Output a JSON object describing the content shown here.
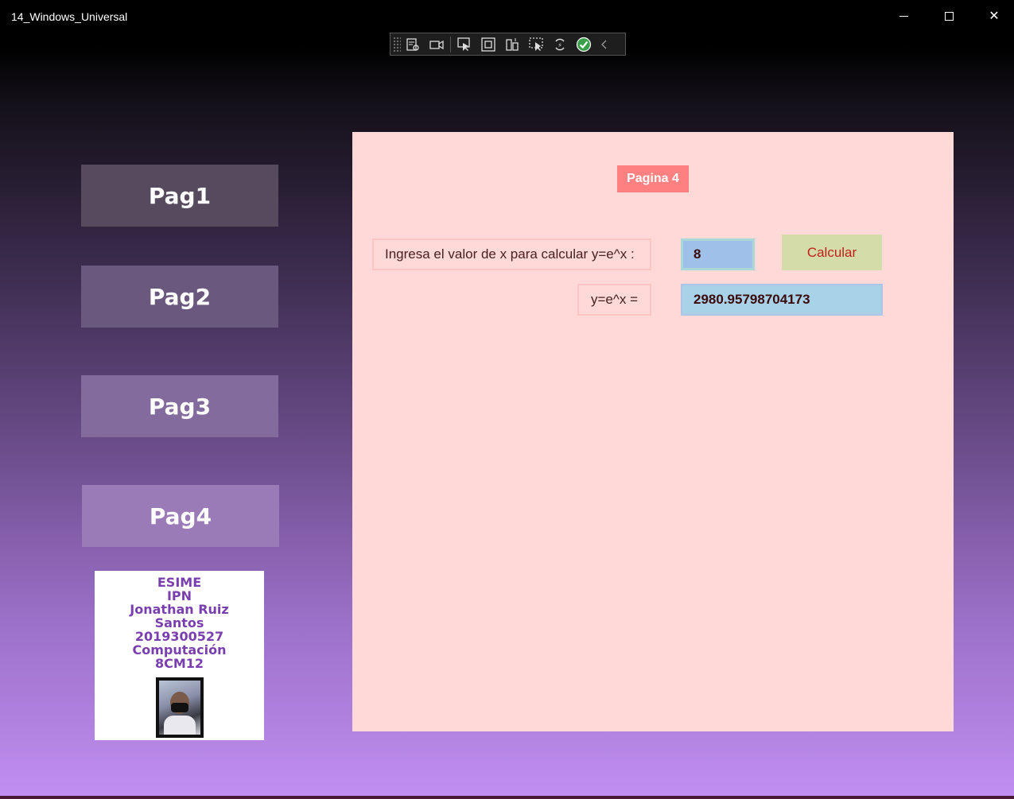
{
  "window": {
    "title": "14_Windows_Universal",
    "controls": {
      "minimize": "minimize-icon",
      "maximize": "maximize-icon",
      "close": "close-icon"
    }
  },
  "debug_toolbar": {
    "tools": [
      "live-visual-tree-icon",
      "record-icon",
      "select-element-icon",
      "display-layout-adorners-icon",
      "track-focus-icon",
      "binding-failures-icon",
      "hot-reload-icon",
      "ok-status-icon",
      "collapse-chevron-icon"
    ]
  },
  "nav": {
    "items": [
      {
        "label": "Pag1"
      },
      {
        "label": "Pag2"
      },
      {
        "label": "Pag3"
      },
      {
        "label": "Pag4"
      }
    ]
  },
  "card": {
    "lines": [
      "ESIME",
      "IPN",
      "Jonathan Ruiz",
      "Santos",
      "2019300527",
      "Computación",
      "8CM12"
    ]
  },
  "page": {
    "label": "Pagina 4",
    "prompt": "Ingresa el valor de x para calcular y=e^x :",
    "x_value": "8",
    "calc_label": "Calcular",
    "result_label": "y=e^x =",
    "result_value": "2980.95798704173"
  },
  "colors": {
    "panel_bg": "#ffd8d8",
    "page_label_bg": "#ff8080",
    "input_bg": "#9fc0e8",
    "button_bg": "#d4dcaa",
    "button_text": "#c0201a"
  }
}
